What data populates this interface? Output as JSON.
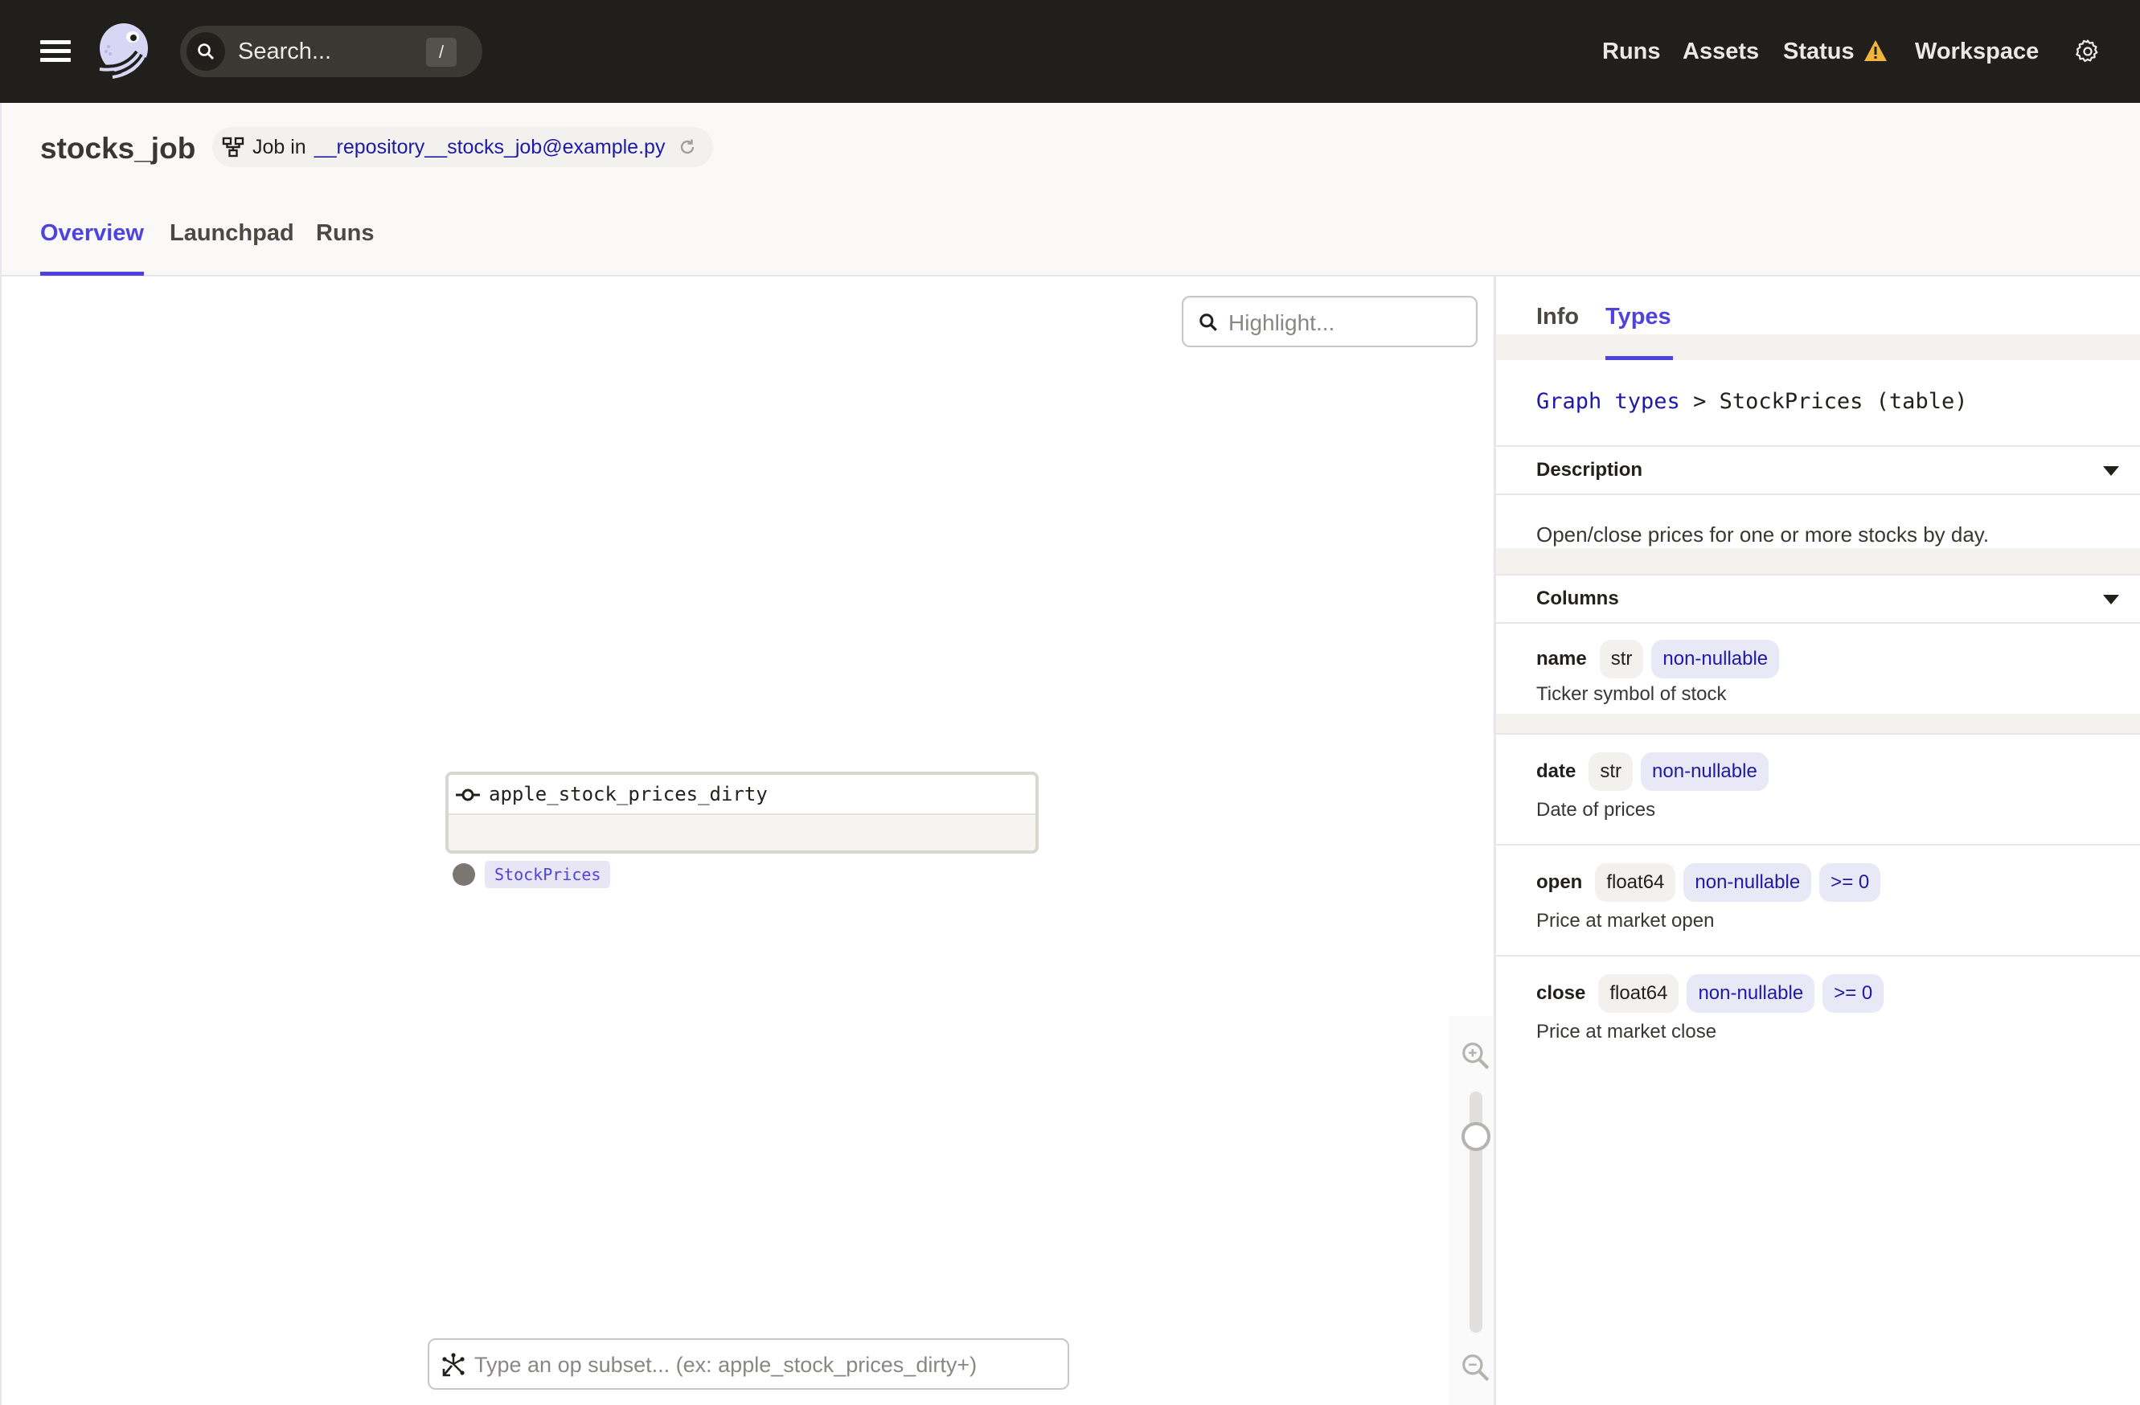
{
  "topbar": {
    "search_placeholder": "Search...",
    "search_shortcut": "/",
    "nav": [
      "Runs",
      "Assets",
      "Status",
      "Workspace"
    ],
    "status_warning_color": "#f2b53c"
  },
  "header": {
    "title": "stocks_job",
    "job_label": "Job in",
    "repository_link": "__repository__stocks_job@example.py",
    "tabs": [
      {
        "label": "Overview",
        "active": true
      },
      {
        "label": "Launchpad",
        "active": false
      },
      {
        "label": "Runs",
        "active": false
      }
    ]
  },
  "canvas": {
    "highlight_placeholder": "Highlight...",
    "node": {
      "name": "apple_stock_prices_dirty",
      "output_type": "StockPrices"
    },
    "op_subset_placeholder": "Type an op subset... (ex: apple_stock_prices_dirty+)"
  },
  "panel": {
    "tabs": [
      {
        "label": "Info",
        "active": false
      },
      {
        "label": "Types",
        "active": true
      }
    ],
    "breadcrumb": {
      "link": "Graph types",
      "separator": ">",
      "current": "StockPrices (table)"
    },
    "description_section": {
      "title": "Description",
      "text": "Open/close prices for one or more stocks by day."
    },
    "columns_section": {
      "title": "Columns",
      "columns": [
        {
          "name": "name",
          "type": "str",
          "constraints": [
            "non-nullable"
          ],
          "description": "Ticker symbol of stock"
        },
        {
          "name": "date",
          "type": "str",
          "constraints": [
            "non-nullable"
          ],
          "description": "Date of prices"
        },
        {
          "name": "open",
          "type": "float64",
          "constraints": [
            "non-nullable",
            ">= 0"
          ],
          "description": "Price at market open"
        },
        {
          "name": "close",
          "type": "float64",
          "constraints": [
            "non-nullable",
            ">= 0"
          ],
          "description": "Price at market close"
        }
      ]
    }
  },
  "colors": {
    "accent": "#4f43dd",
    "link": "#1e1aa6",
    "topbar_bg": "#211f1c"
  }
}
